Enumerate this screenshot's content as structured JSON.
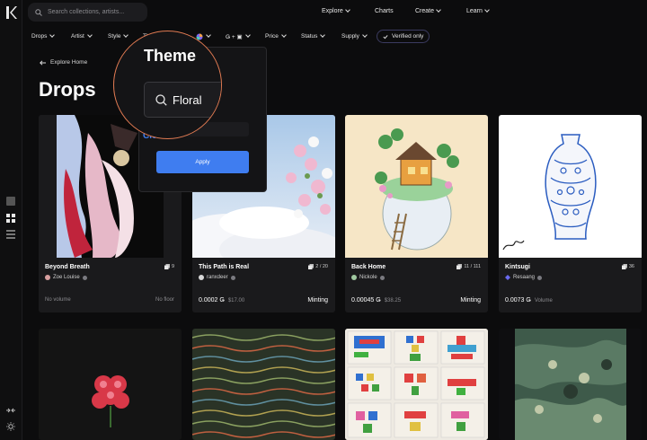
{
  "search": {
    "placeholder": "Search collections, artists..."
  },
  "nav": [
    {
      "label": "Explore",
      "has_menu": true
    },
    {
      "label": "Charts",
      "has_menu": false
    },
    {
      "label": "Create",
      "has_menu": true
    },
    {
      "label": "Learn",
      "has_menu": true
    }
  ],
  "filters": {
    "drops": "Drops",
    "artist": "Artist",
    "style": "Style",
    "theme": "Theme",
    "format": "Ǥ + ▣",
    "price": "Price",
    "status": "Status",
    "supply": "Supply",
    "verified": "Verified only"
  },
  "page": {
    "back_label": "Explore Home",
    "title": "Drops"
  },
  "popover": {
    "heading": "Theme",
    "input_value": "Floral",
    "clear_label": "Clear",
    "apply_label": "Apply"
  },
  "cards": [
    {
      "name": "Beyond Breath",
      "count": "9",
      "creator": "Zoe Louise",
      "volume": "No volume",
      "floor": "No floor"
    },
    {
      "name": "This Path is Real",
      "count": "2 / 20",
      "creator": "ranxdeer",
      "price": "0.0002 Ǥ",
      "usd": "$17.00",
      "status": "Minting"
    },
    {
      "name": "Back Home",
      "count": "11 / 111",
      "creator": "Nickole",
      "price": "0.00045 Ǥ",
      "usd": "$38.25",
      "status": "Minting"
    },
    {
      "name": "Kintsugi",
      "count": "36",
      "creator": "Resaang",
      "price": "0.0073 Ǥ",
      "usd": "Volume"
    }
  ],
  "colors": {
    "accent": "#3f7df0",
    "highlight_ring": "#e07a52",
    "background": "#0c0c0d",
    "card": "#1a1a1c"
  }
}
